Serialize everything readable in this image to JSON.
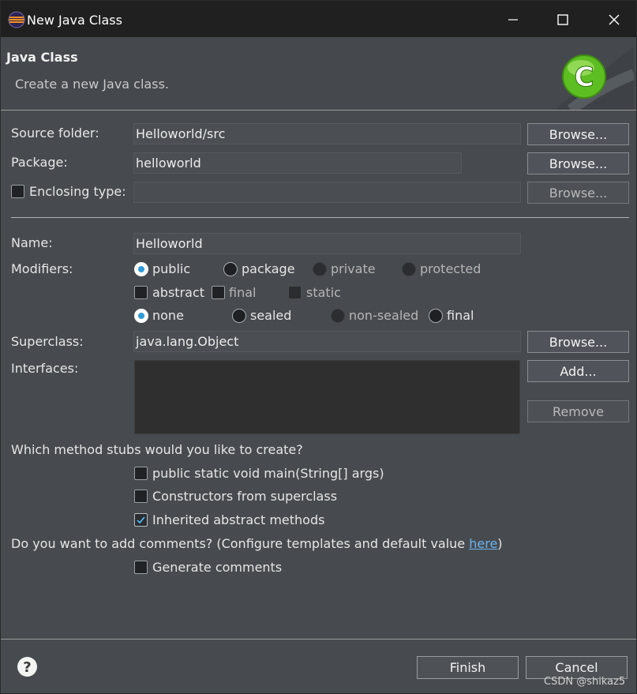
{
  "window": {
    "title": "New Java Class",
    "controls": {
      "minimize": "minimize-icon",
      "maximize": "maximize-icon",
      "close": "close-icon"
    }
  },
  "banner": {
    "title": "Java Class",
    "description": "Create a new Java class."
  },
  "source_folder": {
    "label": "Source folder:",
    "value": "Helloworld/src",
    "button": "Browse..."
  },
  "package": {
    "label": "Package:",
    "value": "helloworld",
    "button": "Browse..."
  },
  "enclosing_type": {
    "label": "Enclosing type:",
    "checked": false,
    "value": "",
    "button": "Browse..."
  },
  "name": {
    "label": "Name:",
    "value": "Helloworld"
  },
  "modifiers": {
    "label": "Modifiers:",
    "access": [
      {
        "label": "public",
        "selected": true,
        "enabled": true
      },
      {
        "label": "package",
        "selected": false,
        "enabled": true
      },
      {
        "label": "private",
        "selected": false,
        "enabled": false
      },
      {
        "label": "protected",
        "selected": false,
        "enabled": false
      }
    ],
    "flags": [
      {
        "label": "abstract",
        "checked": false,
        "enabled": true
      },
      {
        "label": "final",
        "checked": false,
        "enabled": true
      },
      {
        "label": "static",
        "checked": false,
        "enabled": false
      }
    ],
    "sealing": [
      {
        "label": "none",
        "selected": true,
        "enabled": true
      },
      {
        "label": "sealed",
        "selected": false,
        "enabled": true
      },
      {
        "label": "non-sealed",
        "selected": false,
        "enabled": false
      },
      {
        "label": "final",
        "selected": false,
        "enabled": true
      }
    ]
  },
  "superclass": {
    "label": "Superclass:",
    "value": "java.lang.Object",
    "button": "Browse..."
  },
  "interfaces": {
    "label": "Interfaces:",
    "add_button": "Add...",
    "remove_button": "Remove"
  },
  "method_stubs": {
    "question": "Which method stubs would you like to create?",
    "options": [
      {
        "label": "public static void main(String[] args)",
        "checked": false
      },
      {
        "label": "Constructors from superclass",
        "checked": false
      },
      {
        "label": "Inherited abstract methods",
        "checked": true
      }
    ]
  },
  "comments": {
    "question": "Do you want to add comments? (Configure templates and default value ",
    "link": "here",
    "question_end": ")",
    "option": {
      "label": "Generate comments",
      "checked": false
    }
  },
  "footer": {
    "finish": "Finish",
    "cancel": "Cancel",
    "help_icon": "help-icon"
  },
  "watermark": "CSDN @shikaz5",
  "colors": {
    "accent": "#2f9bd7",
    "link": "#6ab3ef",
    "dialog_bg": "#474b4f",
    "titlebar_bg": "#202020"
  }
}
